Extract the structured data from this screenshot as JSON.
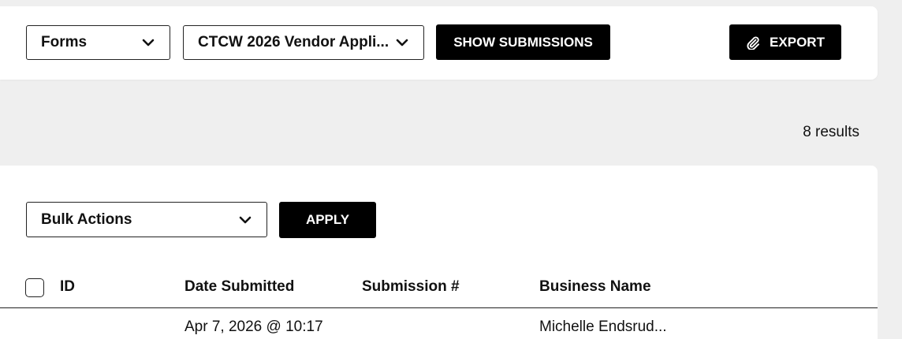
{
  "toolbar": {
    "forms_select": "Forms",
    "form_select": "CTCW 2026 Vendor Appli...",
    "show_submissions": "SHOW SUBMISSIONS",
    "export": "EXPORT",
    "export_icon": "paperclip-icon"
  },
  "summary": {
    "results": "8 results"
  },
  "bulk": {
    "select": "Bulk Actions",
    "apply": "APPLY"
  },
  "table": {
    "columns": {
      "id": "ID",
      "date": "Date Submitted",
      "submission": "Submission #",
      "business": "Business Name"
    },
    "rows": [
      {
        "date": "Apr 7, 2026 @ 10:17",
        "business": "Michelle Endsrud..."
      }
    ]
  }
}
